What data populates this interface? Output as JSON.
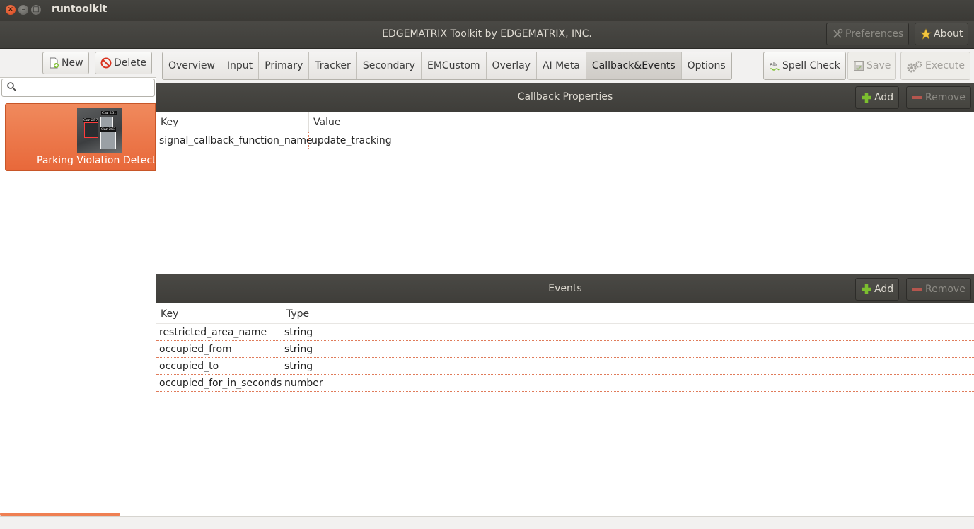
{
  "window": {
    "app_title": "runtoolkit",
    "header_title": "EDGEMATRIX Toolkit by EDGEMATRIX, INC.",
    "preferences_label": "Preferences",
    "about_label": "About"
  },
  "sidebar": {
    "new_label": "New",
    "delete_label": "Delete",
    "search_placeholder": "",
    "projects": [
      {
        "name": "Parking Violation Detector",
        "thumb_labels": [
          "Car 257",
          "Car 251",
          "Car 263"
        ]
      }
    ]
  },
  "tabs": [
    {
      "label": "Overview",
      "active": false
    },
    {
      "label": "Input",
      "active": false
    },
    {
      "label": "Primary",
      "active": false
    },
    {
      "label": "Tracker",
      "active": false
    },
    {
      "label": "Secondary",
      "active": false
    },
    {
      "label": "EMCustom",
      "active": false
    },
    {
      "label": "Overlay",
      "active": false
    },
    {
      "label": "AI Meta",
      "active": false
    },
    {
      "label": "Callback&Events",
      "active": true
    },
    {
      "label": "Options",
      "active": false
    }
  ],
  "toolbar": {
    "spell_check_label": "Spell Check",
    "save_label": "Save",
    "execute_label": "Execute"
  },
  "callback": {
    "title": "Callback Properties",
    "add_label": "Add",
    "remove_label": "Remove",
    "columns": [
      "Key",
      "Value"
    ],
    "rows": [
      [
        "signal_callback_function_name",
        "update_tracking"
      ]
    ]
  },
  "events": {
    "title": "Events",
    "add_label": "Add",
    "remove_label": "Remove",
    "columns": [
      "Key",
      "Type"
    ],
    "rows": [
      [
        "restricted_area_name",
        "string"
      ],
      [
        "occupied_from",
        "string"
      ],
      [
        "occupied_to",
        "string"
      ],
      [
        "occupied_for_in_seconds",
        "number"
      ]
    ]
  },
  "colors": {
    "accent": "#e8683a",
    "dark_bar": "#3f3e3a",
    "add_icon": "#7cbf2f",
    "remove_icon": "#d9534f"
  }
}
